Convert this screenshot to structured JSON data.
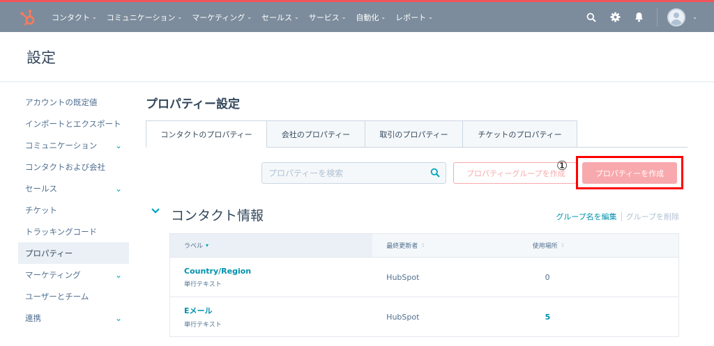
{
  "topbar": {
    "nav": [
      {
        "label": "コンタクト"
      },
      {
        "label": "コミュニケーション"
      },
      {
        "label": "マーケティング"
      },
      {
        "label": "セールス"
      },
      {
        "label": "サービス"
      },
      {
        "label": "自動化"
      },
      {
        "label": "レポート"
      }
    ],
    "icons": [
      "sprocket-logo-icon",
      "search-icon",
      "gear-icon",
      "bell-icon",
      "avatar",
      "chevron-down-icon"
    ]
  },
  "page": {
    "title": "設定"
  },
  "sidebar": {
    "items": [
      {
        "label": "アカウントの既定値",
        "expandable": false
      },
      {
        "label": "インポートとエクスポート",
        "expandable": false
      },
      {
        "label": "コミュニケーション",
        "expandable": true
      },
      {
        "label": "コンタクトおよび会社",
        "expandable": false
      },
      {
        "label": "セールス",
        "expandable": true
      },
      {
        "label": "チケット",
        "expandable": false
      },
      {
        "label": "トラッキングコード",
        "expandable": false
      },
      {
        "label": "プロパティー",
        "expandable": false,
        "active": true
      },
      {
        "label": "マーケティング",
        "expandable": true
      },
      {
        "label": "ユーザーとチーム",
        "expandable": false
      },
      {
        "label": "連携",
        "expandable": true
      }
    ]
  },
  "main": {
    "title": "プロパティー設定",
    "tabs": [
      {
        "label": "コンタクトのプロパティー",
        "active": true
      },
      {
        "label": "会社のプロパティー"
      },
      {
        "label": "取引のプロパティー"
      },
      {
        "label": "チケットのプロパティー"
      }
    ],
    "search": {
      "placeholder": "プロパティーを検索"
    },
    "create_group_label": "プロパティーグループを作成",
    "create_property_label": "プロパティーを作成",
    "annotation_marker": "①",
    "group": {
      "title": "コンタクト情報",
      "edit_label": "グループ名を編集",
      "delete_label": "グループを削除"
    },
    "table": {
      "headers": [
        "ラベル",
        "最終更新者",
        "使用場所"
      ],
      "rows": [
        {
          "name": "Country/Region",
          "type": "単行テキスト",
          "updater": "HubSpot",
          "usage": "0"
        },
        {
          "name": "Eメール",
          "type": "単行テキスト",
          "updater": "HubSpot",
          "usage": "5"
        }
      ]
    }
  },
  "colors": {
    "topbar": "#7c8c9c",
    "accent_teal": "#00a4bd",
    "link": "#0091ae",
    "primary_button": "#f8a9ad",
    "highlight_box": "#ff0000"
  }
}
